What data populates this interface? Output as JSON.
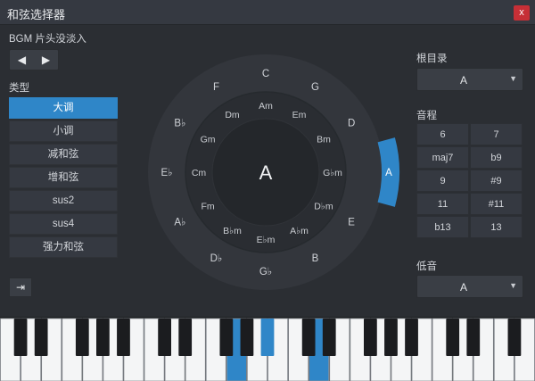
{
  "window": {
    "title": "和弦选择器",
    "close": "x"
  },
  "left": {
    "bgm_label": "BGM 片头没淡入",
    "nav": {
      "prev": "◀",
      "next": "▶"
    },
    "type_label": "类型",
    "types": [
      "大调",
      "小调",
      "减和弦",
      "增和弦",
      "sus2",
      "sus4",
      "强力和弦"
    ],
    "active_type_index": 0,
    "export_icon": "⇥"
  },
  "wheel": {
    "center": "A",
    "outer": [
      "C",
      "G",
      "D",
      "A",
      "E",
      "B",
      "G♭",
      "D♭",
      "A♭",
      "E♭",
      "B♭",
      "F"
    ],
    "inner": [
      "Am",
      "Em",
      "Bm",
      "G♭m",
      "D♭m",
      "A♭m",
      "E♭m",
      "B♭m",
      "Fm",
      "Cm",
      "Gm",
      "Dm"
    ],
    "selected_index": 3,
    "colors": {
      "accent": "#2f86c8",
      "outer_ring": "#33363c",
      "inner_ring": "#2a2d32",
      "center": "#24272b"
    }
  },
  "right": {
    "root_label": "根目录",
    "root_value": "A",
    "interval_label": "音程",
    "intervals": [
      "6",
      "7",
      "maj7",
      "b9",
      "9",
      "#9",
      "11",
      "#11",
      "b13",
      "13"
    ],
    "bass_label": "低音",
    "bass_value": "A"
  },
  "piano": {
    "white_keys": 26,
    "highlighted_white": [
      11,
      15
    ],
    "highlighted_black": [
      9
    ]
  }
}
